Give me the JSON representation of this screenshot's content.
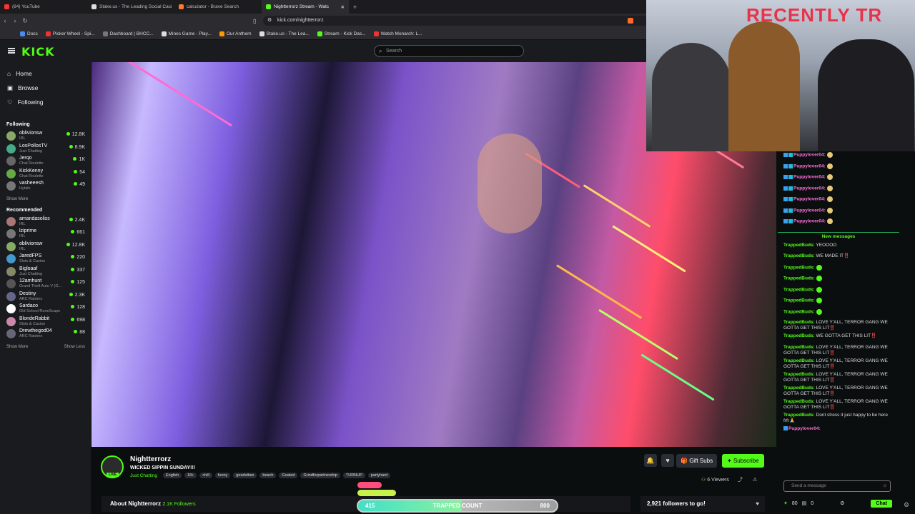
{
  "browser": {
    "tabs": [
      {
        "label": "(84) YouTube",
        "color": "#ff3333"
      },
      {
        "label": "Stake.us - The Leading Social Casi",
        "color": "#ffffff"
      },
      {
        "label": "calculator - Brave Search",
        "color": "#ff7a33"
      },
      {
        "label": "Nightterrorz Stream - Watc",
        "color": "#53fc18"
      }
    ],
    "url": "kick.com/nightterrorz",
    "bookmarks": [
      "Docs",
      "Picker Wheel - Spi...",
      "Dashboard | BHCC...",
      "Mines Game - Play...",
      "Our Anthem",
      "Stake.us - The Lea...",
      "Stream - Kick Das...",
      "Watch Monarch: L..."
    ]
  },
  "header": {
    "logo": "KICK",
    "search_placeholder": "Search"
  },
  "sidebar": {
    "nav": [
      "Home",
      "Browse",
      "Following"
    ],
    "following_title": "Following",
    "following": [
      {
        "name": "oblivionsw",
        "sub": "IRL",
        "count": "12.8K",
        "color": "#8a6"
      },
      {
        "name": "LosPollosTV",
        "sub": "Just Chatting",
        "count": "8.9K",
        "color": "#4a8"
      },
      {
        "name": "Jerqo",
        "sub": "Chat Roulette",
        "count": "1K",
        "color": "#666"
      },
      {
        "name": "KickKenny",
        "sub": "Chat Roulette",
        "count": "54",
        "color": "#6a4"
      },
      {
        "name": "vasheeesh",
        "sub": "Hytale",
        "count": "49",
        "color": "#777"
      }
    ],
    "show_more": "Show More",
    "recommended_title": "Recommended",
    "recommended": [
      {
        "name": "amandasoliss",
        "sub": "IRL",
        "count": "2.4K",
        "color": "#a77"
      },
      {
        "name": "lziprime",
        "sub": "IRL",
        "count": "661",
        "color": "#777"
      },
      {
        "name": "oblivionsw",
        "sub": "IRL",
        "count": "12.8K",
        "color": "#8a6"
      },
      {
        "name": "JaredFPS",
        "sub": "Slots & Casino",
        "count": "220",
        "color": "#49c"
      },
      {
        "name": "Bigloaaf",
        "sub": "Just Chatting",
        "count": "337",
        "color": "#886"
      },
      {
        "name": "12amhunt",
        "sub": "Grand Theft Auto V (G...",
        "count": "125",
        "color": "#555"
      },
      {
        "name": "Destiny",
        "sub": "ARC Raiders",
        "count": "2.3K",
        "color": "#668"
      },
      {
        "name": "Sardaco",
        "sub": "Old School RuneScape",
        "count": "128",
        "color": "#fff"
      },
      {
        "name": "BlondeRabbit",
        "sub": "Slots & Casino",
        "count": "698",
        "color": "#c8a"
      },
      {
        "name": "Drewthegod04",
        "sub": "ARC Raiders",
        "count": "88",
        "color": "#667"
      }
    ],
    "show_more2": "Show More",
    "show_less": "Show Less"
  },
  "webcam": {
    "overlay_text": "RECENTLY TR"
  },
  "chat": {
    "top_messages": [
      "Puppylover04:",
      "Puppylover04:",
      "Puppylover04:",
      "Puppylover04:",
      "Puppylover04:",
      "Puppylover04:",
      "Puppylover04:"
    ],
    "new_messages_label": "New messages",
    "messages": [
      {
        "user": "TrappedBuds:",
        "text": "YEOOOO"
      },
      {
        "user": "TrappedBuds:",
        "text": "WE MADE IT‼️"
      },
      {
        "user": "TrappedBuds:",
        "text": ""
      },
      {
        "user": "TrappedBuds:",
        "text": ""
      },
      {
        "user": "TrappedBuds:",
        "text": ""
      },
      {
        "user": "TrappedBuds:",
        "text": ""
      },
      {
        "user": "TrappedBuds:",
        "text": ""
      },
      {
        "user": "TrappedBuds:",
        "text": "LOVE Y'ALL, TERROR GANG WE GOTTA GET THIS LIT‼️"
      },
      {
        "user": "TrappedBuds:",
        "text": "WE GOTTA GET THIS LIT‼️"
      },
      {
        "user": "TrappedBuds:",
        "text": "LOVE Y'ALL, TERROR GANG WE GOTTA GET THIS LIT‼️"
      },
      {
        "user": "TrappedBuds:",
        "text": "LOVE Y'ALL, TERROR GANG WE GOTTA GET THIS LIT‼️"
      },
      {
        "user": "TrappedBuds:",
        "text": "LOVE Y'ALL, TERROR GANG WE GOTTA GET THIS LIT‼️"
      },
      {
        "user": "TrappedBuds:",
        "text": "LOVE Y'ALL, TERROR GANG WE GOTTA GET THIS LIT‼️"
      },
      {
        "user": "TrappedBuds:",
        "text": "LOVE Y'ALL, TERROR GANG WE GOTTA GET THIS LIT‼️"
      },
      {
        "user": "TrappedBuds:",
        "text": "Dont stress it just happy to be here frfr🙏"
      }
    ],
    "last_user": "Puppylover04:",
    "input_placeholder": "Send a message",
    "points": "80",
    "zero": "0",
    "send_label": "Chat"
  },
  "stream": {
    "channel": "Nightterrorz",
    "live_badge": "LIVE",
    "title": "WICKED SIPPIN SUNDAY!!!",
    "category": "Just Chatting",
    "tags": [
      "English",
      "18+",
      "chill",
      "funny",
      "goodvibes",
      "beach",
      "Goated",
      "Grindforpartnership",
      "TURNUP",
      "partyhard"
    ],
    "gift_label": "Gift Subs",
    "subscribe_label": "Subscribe",
    "viewers": "6 Viewers",
    "about_label": "About Nightterrorz",
    "followers": "2.1K Followers",
    "followers_goal": "2,921 followers to go!"
  },
  "trap_bar": {
    "left": "415",
    "label": "TRAPPED COUNT",
    "right": "800",
    "progress": 0.52
  }
}
